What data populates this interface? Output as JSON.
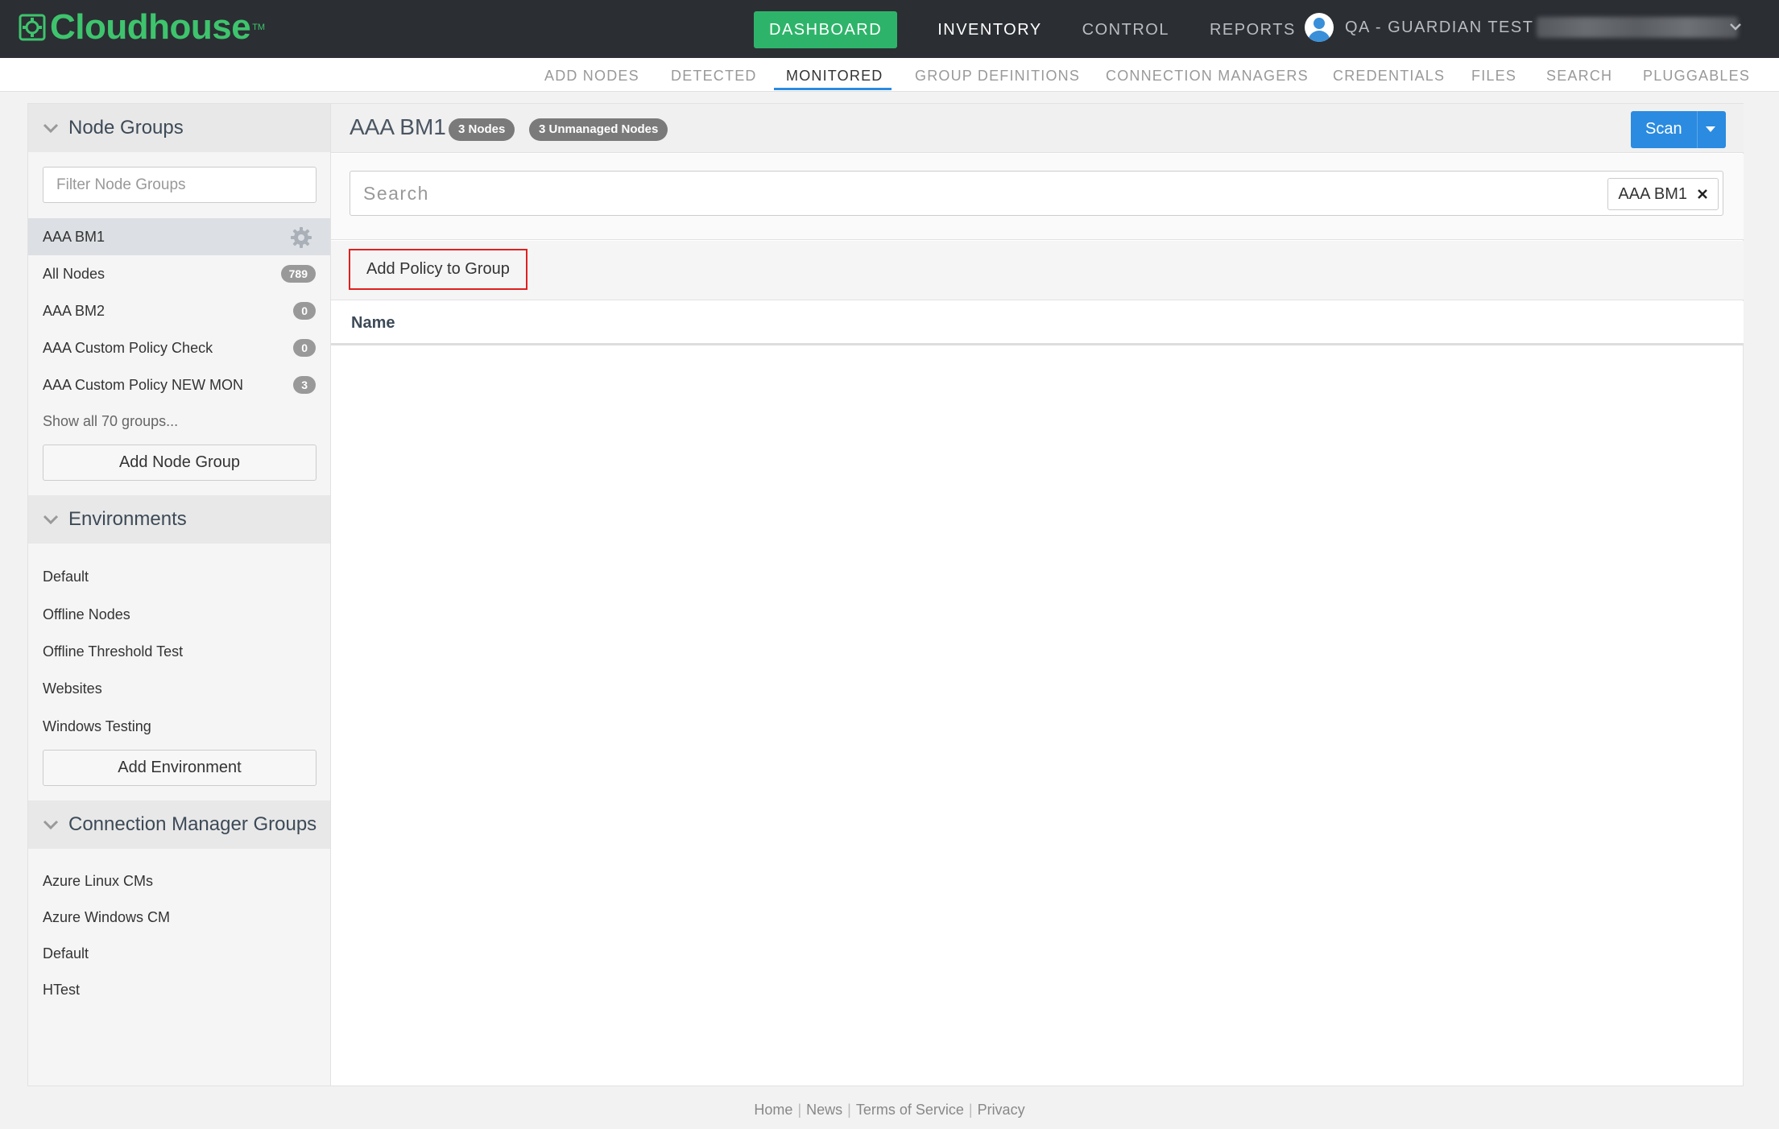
{
  "app": {
    "logo_text": "Cloudhouse",
    "logo_tm": "TM"
  },
  "topnav": {
    "dashboard": "DASHBOARD",
    "inventory": "INVENTORY",
    "control": "CONTROL",
    "reports": "REPORTS",
    "user_name": "QA - GUARDIAN TEST"
  },
  "subnav": [
    "ADD NODES",
    "DETECTED",
    "MONITORED",
    "GROUP DEFINITIONS",
    "CONNECTION MANAGERS",
    "CREDENTIALS",
    "FILES",
    "SEARCH",
    "PLUGGABLES"
  ],
  "subnav_active": "MONITORED",
  "sidebar": {
    "node_groups_title": "Node Groups",
    "filter_placeholder": "Filter Node Groups",
    "node_groups": [
      {
        "label": "AAA BM1",
        "selected": true
      },
      {
        "label": "All Nodes",
        "count": "789"
      },
      {
        "label": "AAA BM2",
        "count": "0"
      },
      {
        "label": "AAA Custom Policy Check",
        "count": "0"
      },
      {
        "label": "AAA Custom Policy NEW MON",
        "count": "3"
      }
    ],
    "show_all": "Show all 70 groups...",
    "add_node_group": "Add Node Group",
    "environments_title": "Environments",
    "environments": [
      "Default",
      "Offline Nodes",
      "Offline Threshold Test",
      "Websites",
      "Windows Testing"
    ],
    "add_environment": "Add Environment",
    "cm_groups_title": "Connection Manager Groups",
    "cm_groups": [
      "Azure Linux CMs",
      "Azure Windows CM",
      "Default",
      "HTest"
    ]
  },
  "content": {
    "title": "AAA BM1",
    "badge_nodes": "3 Nodes",
    "badge_unmanaged": "3 Unmanaged Nodes",
    "scan_label": "Scan",
    "search_placeholder": "Search",
    "chip_label": "AAA BM1",
    "add_policy_label": "Add Policy to Group",
    "column_name": "Name"
  },
  "footer": {
    "links": [
      "Home",
      "News",
      "Terms of Service",
      "Privacy"
    ]
  },
  "colors": {
    "topbar": "#2b2e33",
    "brand_green": "#3ec46d",
    "dashboard_button": "#2eb46a",
    "accent_blue": "#2a8be0",
    "highlight_red": "#e02020"
  }
}
